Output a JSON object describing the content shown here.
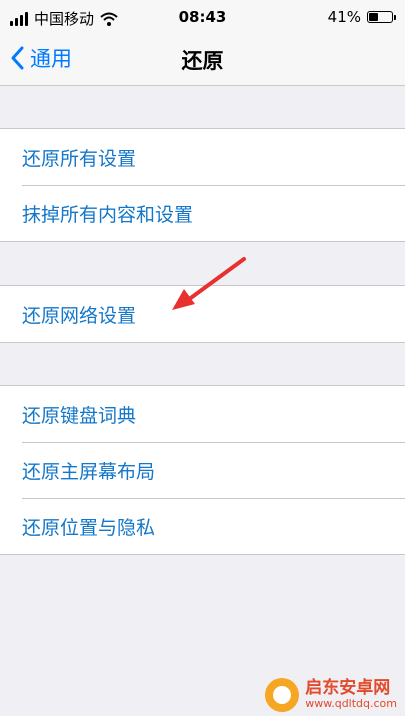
{
  "status_bar": {
    "carrier": "中国移动",
    "time": "08:43",
    "battery_percent": "41%",
    "battery_level": 0.41,
    "icons": [
      "signal-icon",
      "wifi-icon",
      "battery-icon"
    ]
  },
  "nav": {
    "back_label": "通用",
    "title": "还原"
  },
  "groups": [
    {
      "items": [
        "还原所有设置",
        "抹掉所有内容和设置"
      ]
    },
    {
      "items": [
        "还原网络设置"
      ]
    },
    {
      "items": [
        "还原键盘词典",
        "还原主屏幕布局",
        "还原位置与隐私"
      ]
    }
  ],
  "annotation": {
    "arrow_color": "#e8302f"
  },
  "watermark": {
    "name": "启东安卓网",
    "url": "www.qdltdq.com"
  },
  "colors": {
    "link": "#1477c9",
    "back": "#007aff",
    "background": "#efeff4"
  }
}
